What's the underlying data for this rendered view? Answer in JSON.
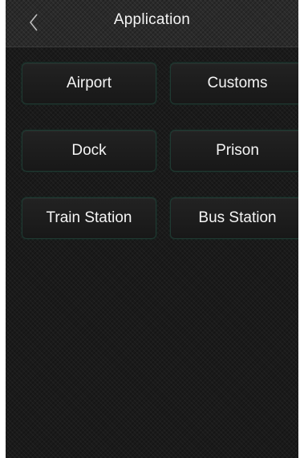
{
  "header": {
    "title": "Application",
    "back_icon": "chevron-left-icon"
  },
  "buttons": {
    "airport": "Airport",
    "customs": "Customs",
    "dock": "Dock",
    "prison": "Prison",
    "train_station": "Train Station",
    "bus_station": "Bus Station"
  },
  "colors": {
    "background": "#1a1a1a",
    "button_border": "#1f3a32",
    "text": "#f5f5f5"
  }
}
